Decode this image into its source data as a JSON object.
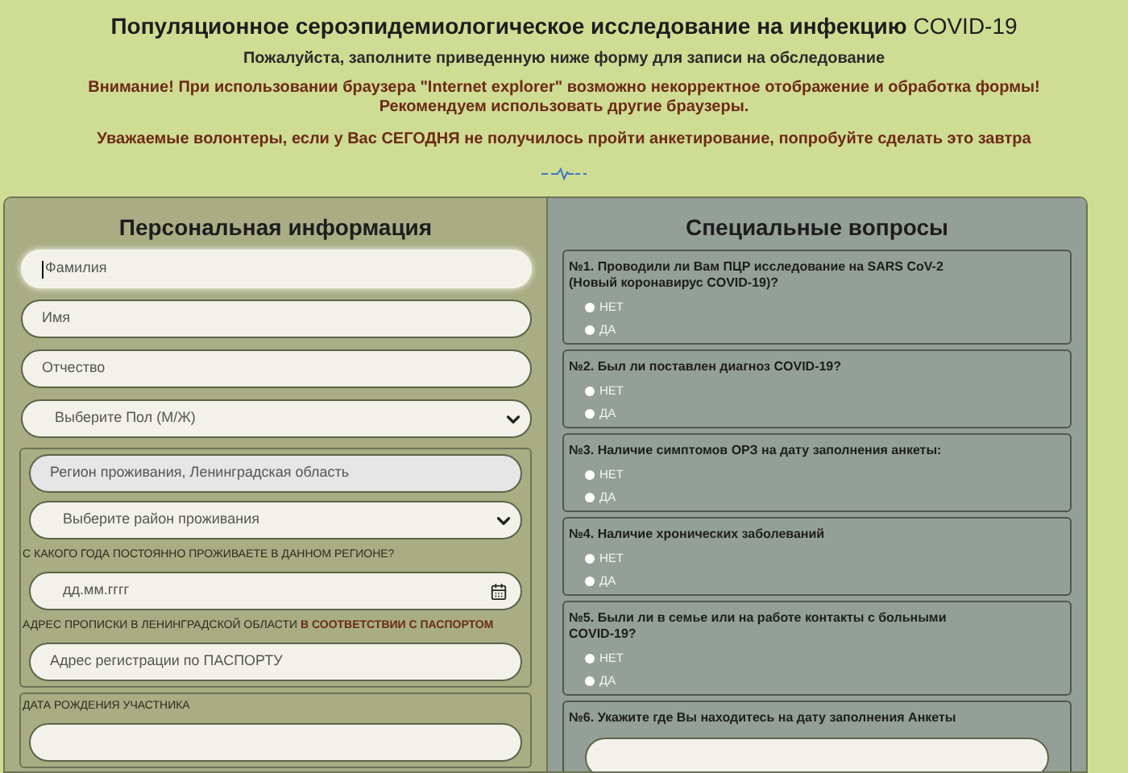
{
  "header": {
    "title": "Популяционное сероэпидемиологическое исследование на инфекцию",
    "title_suffix": "COVID-19",
    "subtitle": "Пожалуйста, заполните приведенную ниже форму для записи на обследование",
    "warning": [
      "Внимание! При использовании браузера \"Internet explorer\" возможно некорректное отображение и обработка формы!",
      "Рекомендуем использовать другие браузеры."
    ],
    "notice": "Уважаемые волонтеры, если у Вас СЕГОДНЯ не получилось пройти анкетирование, попробуйте сделать это завтра"
  },
  "personal": {
    "heading": "Персональная информация",
    "fields": [
      {
        "kind": "text",
        "placeholder": "Фамилия",
        "focused": true
      },
      {
        "kind": "text",
        "placeholder": "Имя"
      },
      {
        "kind": "text",
        "placeholder": "Отчество"
      },
      {
        "kind": "select",
        "placeholder": "Выберите Пол (М/Ж)"
      }
    ],
    "groups": [
      {
        "fields": [
          {
            "kind": "text",
            "value": "Регион проживания, Ленинградская область",
            "disabled": true
          },
          {
            "kind": "select",
            "placeholder": "Выберите район проживания"
          },
          {
            "kind": "label",
            "text": "С КАКОГО ГОДА ПОСТОЯННО ПРОЖИВАЕТЕ В ДАННОМ РЕГИОНЕ?"
          },
          {
            "kind": "date",
            "placeholder": "дд.мм.гггг"
          },
          {
            "kind": "label",
            "text": "АДРЕС ПРОПИСКИ В ЛЕНИНГРАДСКОЙ ОБЛАСТИ **В СООТВЕТСТВИИ С ПАСПОРТОМ**"
          },
          {
            "kind": "text",
            "placeholder": "Адрес регистрации по ПАСПОРТУ"
          }
        ]
      },
      {
        "fields": [
          {
            "kind": "label",
            "text": "ДАТА РОЖДЕНИЯ УЧАСТНИКА"
          },
          {
            "kind": "text"
          }
        ]
      }
    ]
  },
  "special": {
    "heading": "Специальные вопросы",
    "questions": [
      {
        "text": "№1. Проводили ли Вам ПЦР исследование на SARS CoV-2 (Новый коронавирус COVID-19)?",
        "options": [
          {
            "label": "НЕТ",
            "selected": false
          },
          {
            "label": "ДА",
            "selected": false
          }
        ]
      },
      {
        "text": "№2. Был ли поставлен диагноз COVID-19?",
        "options": [
          {
            "label": "НЕТ",
            "selected": false
          },
          {
            "label": "ДА",
            "selected": false
          }
        ]
      },
      {
        "text": "№3. Наличие симптомов ОРЗ на дату заполнения анкеты:",
        "options": [
          {
            "label": "НЕТ",
            "selected": false
          },
          {
            "label": "ДА",
            "selected": false
          }
        ]
      },
      {
        "text": "№4. Наличие хронических заболеваний",
        "options": [
          {
            "label": "НЕТ",
            "selected": false
          },
          {
            "label": "ДА",
            "selected": false
          }
        ]
      },
      {
        "text": "№5. Были ли в семье или на работе контакты с больными COVID-19?",
        "options": [
          {
            "label": "НЕТ",
            "selected": false
          },
          {
            "label": "ДА",
            "selected": false
          }
        ]
      },
      {
        "text": "№6. Укажите где Вы находитесь на дату заполнения Анкеты",
        "kind": "text"
      }
    ]
  }
}
